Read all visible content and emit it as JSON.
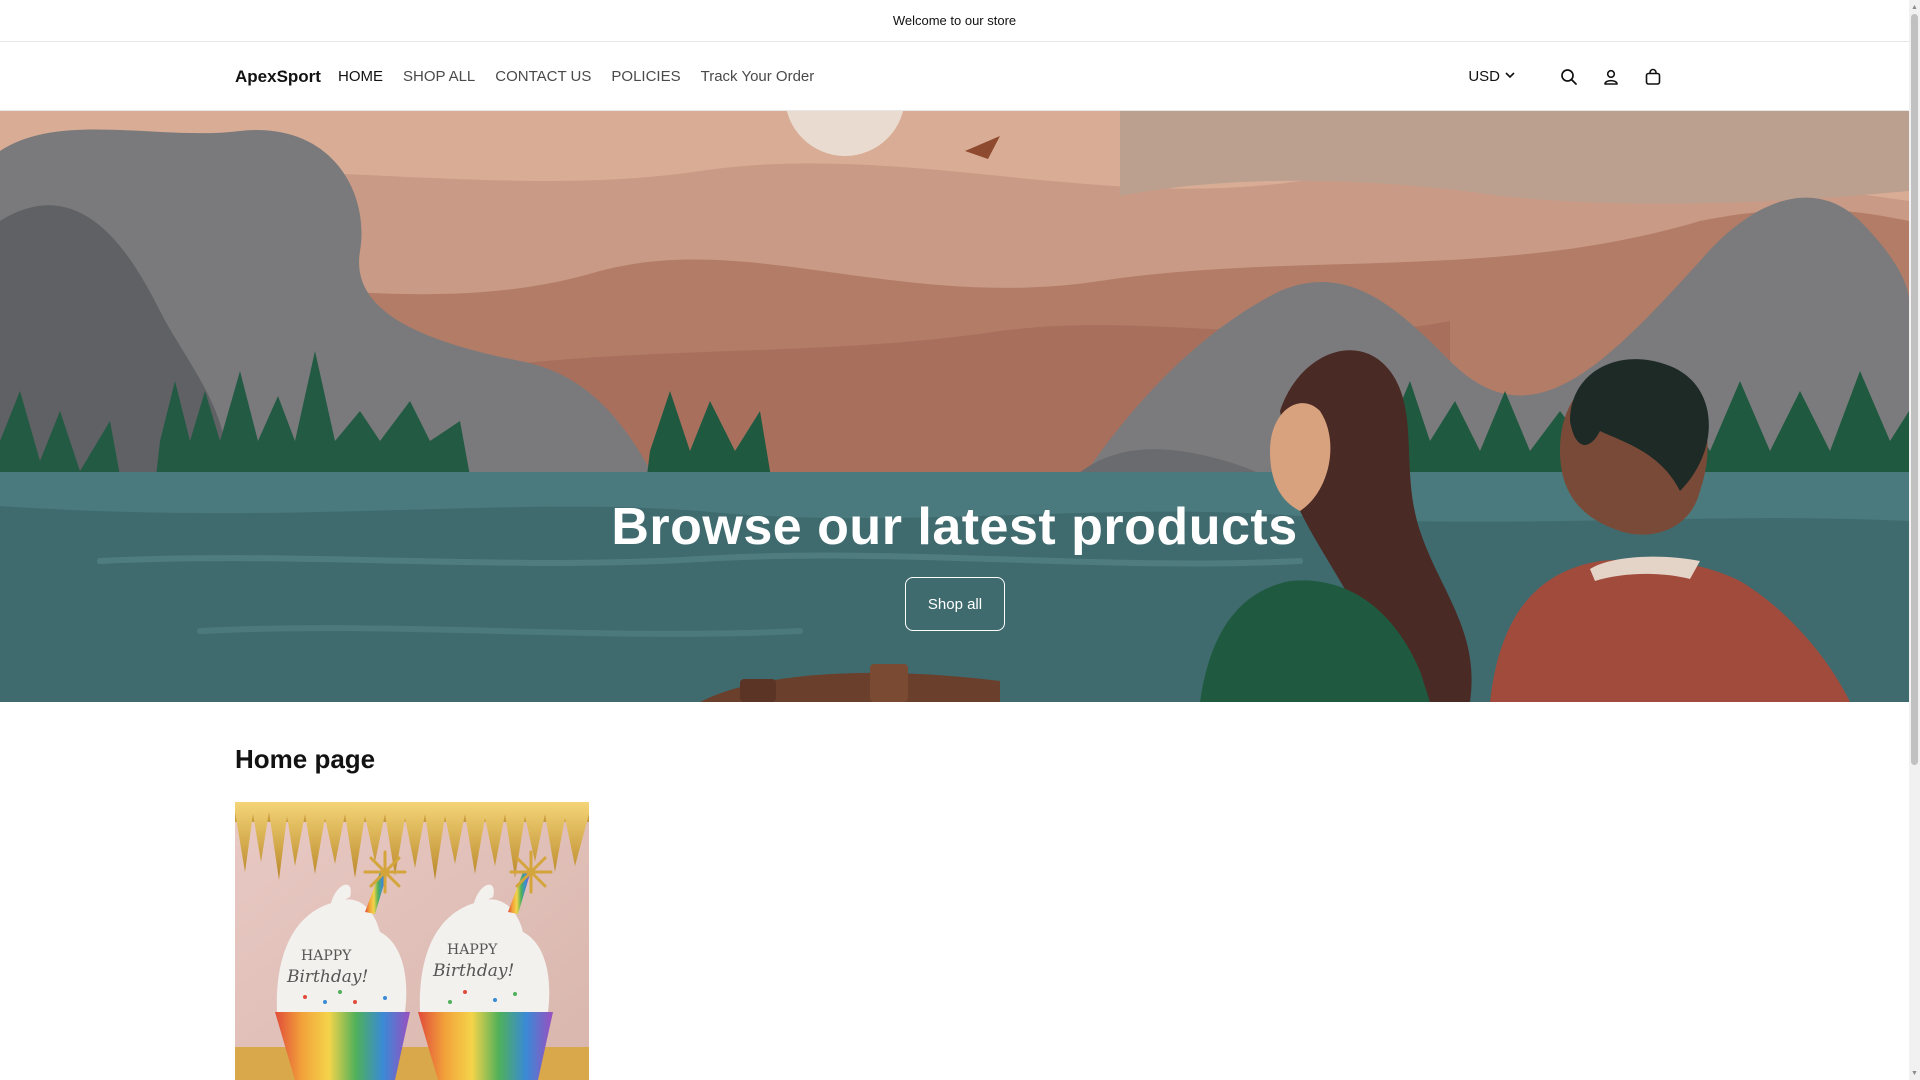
{
  "announcement": {
    "text": "Welcome to our store"
  },
  "header": {
    "logo": "ApexSport",
    "nav": [
      "HOME",
      "SHOP ALL",
      "CONTACT US",
      "POLICIES",
      "Track Your Order"
    ],
    "active_nav_index": 0,
    "currency": "USD",
    "icons": [
      "search-icon",
      "account-icon",
      "cart-icon"
    ]
  },
  "hero": {
    "title": "Browse our latest products",
    "button_label": "Shop all"
  },
  "section": {
    "title": "Home page",
    "card_image_text": [
      "HAPPY",
      "Birthday!",
      "HAPPY",
      "Birthday!"
    ]
  }
}
